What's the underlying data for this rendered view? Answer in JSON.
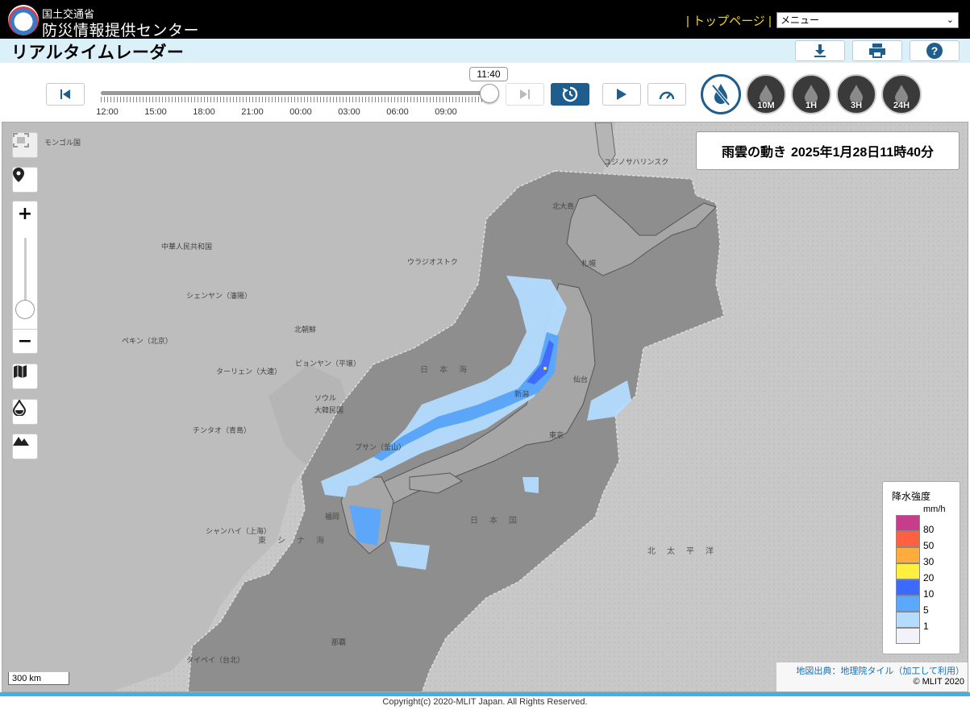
{
  "header": {
    "org_line1": "国土交通省",
    "org_line2": "防災情報提供センター",
    "top_link": "トップページ",
    "top_link_sep": "|",
    "menu_value": "メニュー"
  },
  "page_title": "リアルタイムレーダー",
  "toolbar": {
    "download_icon": "download-icon",
    "print_icon": "print-icon",
    "help_icon": "help-icon"
  },
  "playback": {
    "current_time": "11:40",
    "progress_fraction": 1.0,
    "tick_labels": [
      "12:00",
      "15:00",
      "18:00",
      "21:00",
      "00:00",
      "03:00",
      "06:00",
      "09:00"
    ]
  },
  "rain_buttons": [
    "10M",
    "1H",
    "3H",
    "24H"
  ],
  "map": {
    "timestamp_title": "雨雲の動き",
    "timestamp_value": "2025年1月28日11時40分",
    "labels": {
      "mongol": "モンゴル国",
      "china": "中華人民共和国",
      "vladivostok": "ウラジオストク",
      "shenyang": "シェンヤン（瀋陽）",
      "beijing": "ペキン（北京）",
      "dalian": "ターリェン（大連）",
      "nk": "北朝鮮",
      "pyongyang": "ピョンヤン（平壌）",
      "seoul": "ソウル",
      "korea": "大韓民国",
      "qingdao": "チンタオ（青島）",
      "busan": "プサン（釜山）",
      "shanghai": "シャンハイ（上海）",
      "taipei": "タイペイ（台北）",
      "sakhalin": "ユジノサハリンスク",
      "wakkanai": "北大島",
      "sapporo": "札幌",
      "sendai": "仙台",
      "tokyo": "東京",
      "niigata": "新潟",
      "fukuoka": "福岡",
      "naha": "那覇"
    },
    "seas": {
      "japan_sea": "日本海",
      "east_china_sea": "東シナ海",
      "pacific": "北太平洋",
      "japan": "日本国"
    }
  },
  "legend": {
    "title": "降水強度",
    "unit": "mm/h",
    "levels": [
      {
        "value": "80",
        "color": "#c83c8c"
      },
      {
        "value": "50",
        "color": "#ff6040"
      },
      {
        "value": "30",
        "color": "#ffac3c"
      },
      {
        "value": "20",
        "color": "#fff040"
      },
      {
        "value": "10",
        "color": "#3c6aff"
      },
      {
        "value": "5",
        "color": "#5aa8ff"
      },
      {
        "value": "1",
        "color": "#b4dcff"
      },
      {
        "value": "",
        "color": "#f2f2fa"
      }
    ]
  },
  "scale": "300 km",
  "attribution": {
    "source": "地図出典：地理院タイル（加工して利用）",
    "copyright": "© MLIT 2020"
  },
  "footer": {
    "copyright": "Copyright(c) 2020-MLIT Japan. All Rights Reserved."
  }
}
